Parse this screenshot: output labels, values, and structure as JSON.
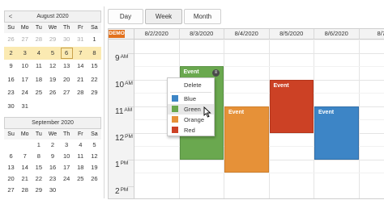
{
  "nav_august": {
    "title": "August 2020",
    "prev": "<",
    "days": [
      "Su",
      "Mo",
      "Tu",
      "We",
      "Th",
      "Fr",
      "Sa"
    ],
    "weeks": [
      [
        "26",
        "27",
        "28",
        "29",
        "30",
        "31",
        "1"
      ],
      [
        "2",
        "3",
        "4",
        "5",
        "6",
        "7",
        "8"
      ],
      [
        "9",
        "10",
        "11",
        "12",
        "13",
        "14",
        "15"
      ],
      [
        "16",
        "17",
        "18",
        "19",
        "20",
        "21",
        "22"
      ],
      [
        "23",
        "24",
        "25",
        "26",
        "27",
        "28",
        "29"
      ],
      [
        "30",
        "31",
        "",
        "",
        "",
        "",
        ""
      ]
    ],
    "other_month_row": 0,
    "other_month_until_col": 5,
    "selected_row": 1,
    "today": "6"
  },
  "nav_september": {
    "title": "September 2020",
    "weeks": [
      [
        "",
        "",
        "1",
        "2",
        "3",
        "4",
        "5"
      ],
      [
        "6",
        "7",
        "8",
        "9",
        "10",
        "11",
        "12"
      ],
      [
        "13",
        "14",
        "15",
        "16",
        "17",
        "18",
        "19"
      ],
      [
        "20",
        "21",
        "22",
        "23",
        "24",
        "25",
        "26"
      ],
      [
        "27",
        "28",
        "29",
        "30",
        "",
        "",
        ""
      ]
    ]
  },
  "toolbar": {
    "day_label": "Day",
    "week_label": "Week",
    "month_label": "Month",
    "active": "Week"
  },
  "scheduler": {
    "corner_badge": "DEMO",
    "columns": [
      "8/2/2020",
      "8/3/2020",
      "8/4/2020",
      "8/5/2020",
      "8/6/2020",
      "8/7"
    ],
    "hours": [
      {
        "h": "9",
        "ap": "AM"
      },
      {
        "h": "10",
        "ap": "AM"
      },
      {
        "h": "11",
        "ap": "AM"
      },
      {
        "h": "12",
        "ap": "PM"
      },
      {
        "h": "1",
        "ap": "PM"
      },
      {
        "h": "2",
        "ap": "PM"
      }
    ],
    "events": [
      {
        "label": "Event",
        "color": "green",
        "day": "8/3/2020",
        "start": "10:00 AM",
        "end": "1:30 PM"
      },
      {
        "label": "Event",
        "color": "orange",
        "day": "8/4/2020",
        "start": "11:30 AM",
        "end": "2:00 PM"
      },
      {
        "label": "Event",
        "color": "red",
        "day": "8/5/2020",
        "start": "10:30 AM",
        "end": "12:30 PM"
      },
      {
        "label": "Event",
        "color": "blue",
        "day": "8/6/2020",
        "start": "11:30 AM",
        "end": "1:30 PM"
      }
    ]
  },
  "context_menu": {
    "items": [
      {
        "label": "Delete",
        "color": ""
      },
      {
        "label": "Blue",
        "color": "#3d85c6"
      },
      {
        "label": "Green",
        "color": "#6aa84f"
      },
      {
        "label": "Orange",
        "color": "#e69138"
      },
      {
        "label": "Red",
        "color": "#cc4125"
      }
    ],
    "hovered": "Green"
  },
  "colors": {
    "green": "#6aa84f",
    "orange": "#e69138",
    "red": "#cc4125",
    "blue": "#3d85c6",
    "demo_badge": "#e2711d",
    "selected_week": "#fbeab2"
  }
}
